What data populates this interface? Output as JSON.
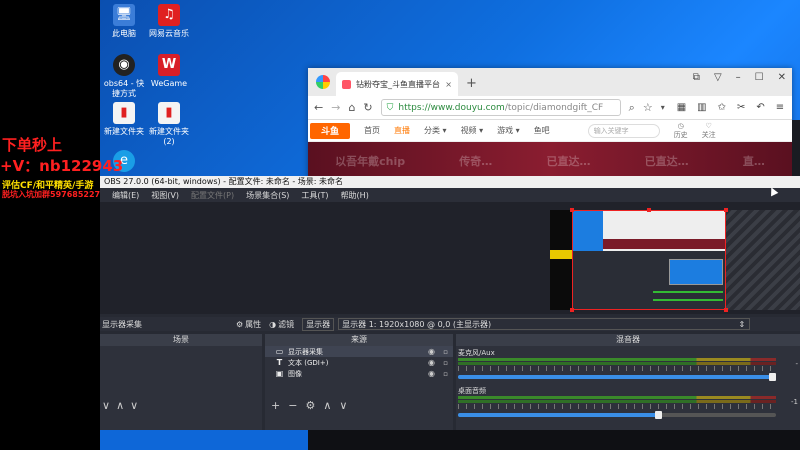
{
  "desktop": {
    "icons": [
      {
        "label": "此电脑",
        "glyph": "🖥",
        "color": "#3b7dd8"
      },
      {
        "label": "网易云音乐",
        "glyph": "♫",
        "color": "#e02020"
      },
      {
        "label": "obs64 - 快捷方式",
        "glyph": "◉",
        "color": "#222222"
      },
      {
        "label": "WeGame",
        "glyph": "W",
        "color": "#d81e28"
      },
      {
        "label": "新建文件夹",
        "glyph": "▮",
        "color": "#f4f4f4"
      },
      {
        "label": "新建文件夹 (2)",
        "glyph": "▮",
        "color": "#f4f4f4"
      },
      {
        "label": "",
        "glyph": "e",
        "color": "#1a9ee6"
      }
    ]
  },
  "overlay": {
    "line1": "下单秒上",
    "line2": "+V：nb122943",
    "line3": "评估CF/和平精英/手游",
    "line4": "脱坑入坑加群597685227"
  },
  "browser": {
    "tab_title": "钻粉夺宝_斗鱼直播平台",
    "url_host": "https://www.douyu.com",
    "url_path": "/topic/diamondgift_CF",
    "site": {
      "logo": "斗鱼",
      "nav": [
        "首页",
        "直播",
        "分类 ▾",
        "视频 ▾",
        "游戏 ▾",
        "鱼吧"
      ],
      "active_nav": "直播",
      "search_placeholder": "输入关键字",
      "right_icons": [
        "历史",
        "关注"
      ],
      "banner_texts": [
        "以吾年戴chip",
        "传奇…",
        "已直达…",
        "已直达…",
        "直…"
      ]
    }
  },
  "obs": {
    "title": "OBS 27.0.0 (64-bit, windows) - 配置文件: 未命名 - 场景: 未命名",
    "menu": [
      "编辑(E)",
      "视图(V)",
      "配置文件(P)",
      "场景集合(S)",
      "工具(T)",
      "帮助(H)"
    ],
    "menu_dim": [
      "配置文件(P)"
    ],
    "toolbar": {
      "selected_source": "显示器采集",
      "properties": "属性",
      "filters": "滤镜",
      "display_label": "显示器",
      "display_value": "显示器 1: 1920x1080 @ 0,0 (主显示器)"
    },
    "scenes_header": "场景",
    "sources_header": "来源",
    "mixer_header": "混音器",
    "sources": [
      {
        "name": "显示器采集",
        "icon": "▭",
        "selected": true
      },
      {
        "name": "文本 (GDI+)",
        "icon": "T",
        "selected": false
      },
      {
        "name": "图像",
        "icon": "▣",
        "selected": false
      }
    ],
    "mixer": [
      {
        "name": "麦克风/Aux",
        "db": "-",
        "volume_pct": 100
      },
      {
        "name": "桌面音频",
        "db": "-1",
        "volume_pct": 64
      }
    ]
  }
}
